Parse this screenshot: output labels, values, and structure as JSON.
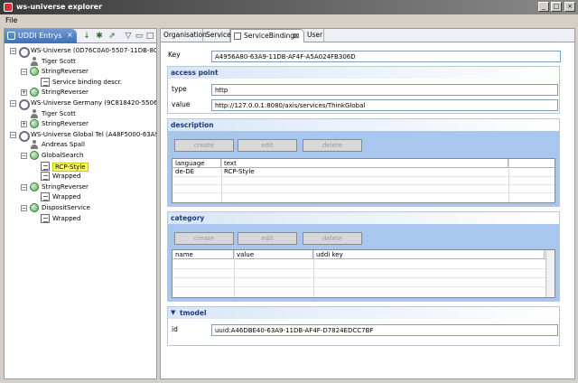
{
  "window": {
    "title": "ws-universe explorer",
    "min": "_",
    "max": "□",
    "close": "×"
  },
  "menu": {
    "file": "File"
  },
  "left_view": {
    "tab_label": "UDDI Entrys",
    "tab_close": "×",
    "tree": [
      {
        "label": "WS-Universe (0D76C0A0-5507-11DB-80A",
        "icon": "universe-icon",
        "expander": "−"
      },
      {
        "label": "Tiger Scott",
        "icon": "user-icon"
      },
      {
        "label": "StringReverser",
        "icon": "service-icon",
        "expander": "−"
      },
      {
        "label": "Service binding descr.",
        "icon": "binding-icon"
      },
      {
        "label": "StringReverser",
        "icon": "service-icon",
        "expander": "+"
      },
      {
        "label": "WS-Universe Germany (9C818420-5506-1",
        "icon": "universe-icon",
        "expander": "−"
      },
      {
        "label": "Tiger Scott",
        "icon": "user-icon"
      },
      {
        "label": "StringReverser",
        "icon": "service-icon",
        "expander": "+"
      },
      {
        "label": "WS-Universe Global Tel (A48F5000-63A9-",
        "icon": "universe-icon",
        "expander": "−"
      },
      {
        "label": "Andreas Spall",
        "icon": "user-icon"
      },
      {
        "label": "GlobalSearch",
        "icon": "service-icon",
        "expander": "−"
      },
      {
        "label": "RCP-Style",
        "icon": "binding-icon",
        "selected": true
      },
      {
        "label": "Wrapped",
        "icon": "binding-icon"
      },
      {
        "label": "StringReverser",
        "icon": "service-icon",
        "expander": "−"
      },
      {
        "label": "Wrapped",
        "icon": "binding-icon"
      },
      {
        "label": "DispositService",
        "icon": "service-icon",
        "expander": "−"
      },
      {
        "label": "Wrapped",
        "icon": "binding-icon"
      }
    ]
  },
  "editor": {
    "tabs": [
      {
        "label": "Organisation"
      },
      {
        "label": "Service"
      },
      {
        "label": "ServiceBinding",
        "active": true,
        "close": "⊠"
      },
      {
        "label": "User"
      }
    ],
    "key_label": "Key",
    "key_value": "A4956A80-63A9-11DB-AF4F-A5A024FB306D",
    "access_point": {
      "title": "access point",
      "type_label": "type",
      "type_value": "http",
      "value_label": "value",
      "value_value": "http://127.0.0.1:8080/axis/services/ThinkGlobal"
    },
    "description": {
      "title": "description",
      "buttons": {
        "create": "create",
        "edit": "edit",
        "delete": "delete"
      },
      "columns": [
        "language",
        "text"
      ],
      "rows": [
        {
          "language": "de-DE",
          "text": "RCP-Style"
        }
      ]
    },
    "category": {
      "title": "category",
      "buttons": {
        "create": "create",
        "edit": "edit",
        "delete": "delete"
      },
      "columns": [
        "name",
        "value",
        "uddi key"
      ],
      "rows": []
    },
    "tmodel": {
      "title": "tmodel",
      "toggle": "▼",
      "id_label": "id",
      "id_value": "uuid:A46DBE40-63A9-11DB-AF4F-D7824EDCC7BF"
    }
  }
}
